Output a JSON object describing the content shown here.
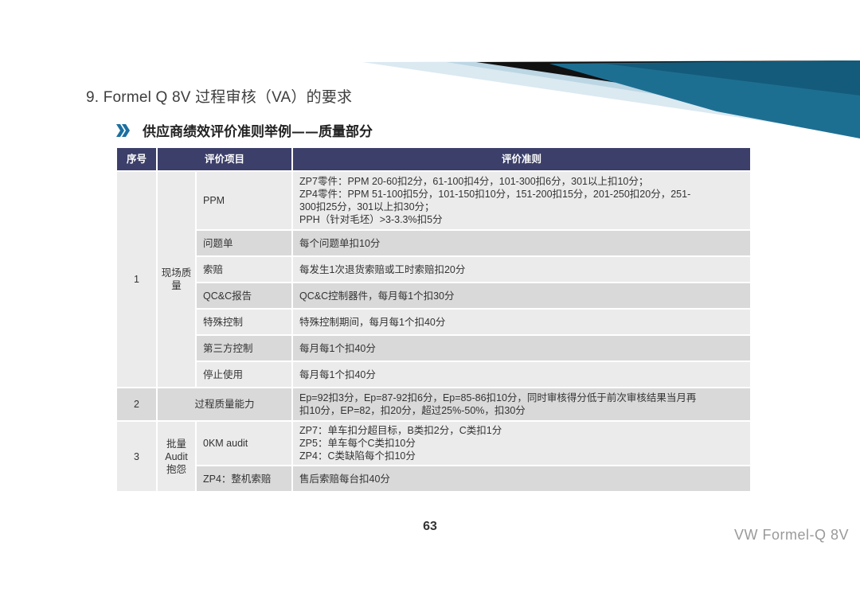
{
  "slide": {
    "title": "9. Formel Q 8V 过程审核（VA）的要求",
    "subtitle": "供应商绩效评价准则举例——质量部分",
    "page_number": "63",
    "footer_brand": "VW Formel-Q  8V"
  },
  "table": {
    "headers": [
      "序号",
      "评价项目",
      "评价准则"
    ],
    "group1": {
      "no": "1",
      "category": "现场质量",
      "rows": [
        {
          "item": "PPM",
          "criteria_lines": [
            "ZP7零件：PPM 20-60扣2分，61-100扣4分，101-300扣6分，301以上扣10分；",
            "ZP4零件：PPM 51-100扣5分，101-150扣10分，151-200扣15分，201-250扣20分，251-",
            "300扣25分，301以上扣30分；",
            "PPH（针对毛坯）>3-3.3%扣5分"
          ]
        },
        {
          "item": "问题单",
          "criteria": "每个问题单扣10分"
        },
        {
          "item": "索赔",
          "criteria": "每发生1次退货索赔或工时索赔扣20分"
        },
        {
          "item": "QC&C报告",
          "criteria": "QC&C控制器件，每月每1个扣30分"
        },
        {
          "item": "特殊控制",
          "criteria": "特殊控制期间，每月每1个扣40分"
        },
        {
          "item": "第三方控制",
          "criteria": "每月每1个扣40分"
        },
        {
          "item": "停止使用",
          "criteria": "每月每1个扣40分"
        }
      ]
    },
    "group2": {
      "no": "2",
      "item": "过程质量能力",
      "criteria_lines": [
        "Ep=92扣3分，Ep=87-92扣6分，Ep=85-86扣10分，同时审核得分低于前次审核结果当月再",
        "扣10分，EP=82，扣20分，超过25%-50%，扣30分"
      ]
    },
    "group3": {
      "no": "3",
      "category": "批量Audit抱怨",
      "rows": [
        {
          "item": "0KM audit",
          "criteria_lines": [
            "ZP7：单车扣分超目标，B类扣2分，C类扣1分",
            "ZP5：单车每个C类扣10分",
            "ZP4：C类缺陷每个扣10分"
          ]
        },
        {
          "item": "ZP4：整机索赔",
          "criteria": "售后索赔每台扣40分"
        }
      ]
    }
  }
}
